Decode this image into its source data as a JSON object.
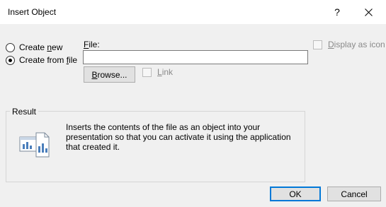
{
  "window": {
    "title": "Insert Object",
    "help_glyph": "?"
  },
  "options": {
    "create_new": {
      "label_prefix": "Create ",
      "label_accel": "n",
      "label_suffix": "ew",
      "selected": false
    },
    "create_from_file": {
      "label_prefix": "Create from ",
      "label_accel": "f",
      "label_suffix": "ile",
      "selected": true
    }
  },
  "file": {
    "label_accel": "F",
    "label_rest": "ile:",
    "value": ""
  },
  "browse": {
    "label_accel": "B",
    "label_rest": "rowse..."
  },
  "link": {
    "label_accel": "L",
    "label_rest": "ink",
    "checked": false,
    "enabled": false
  },
  "display_as_icon": {
    "label_accel": "D",
    "label_rest": "isplay as icon",
    "checked": false,
    "enabled": false
  },
  "result": {
    "heading": "Result",
    "lines": [
      "Inserts the contents of the file as an object into your",
      "presentation so that you can activate it using the application",
      "that created it."
    ],
    "icon": "document-chart-icon"
  },
  "buttons": {
    "ok": "OK",
    "cancel": "Cancel"
  },
  "colors": {
    "accent": "#0078d7",
    "background": "#f0f0f0",
    "disabled_text": "#8a8a8a"
  }
}
